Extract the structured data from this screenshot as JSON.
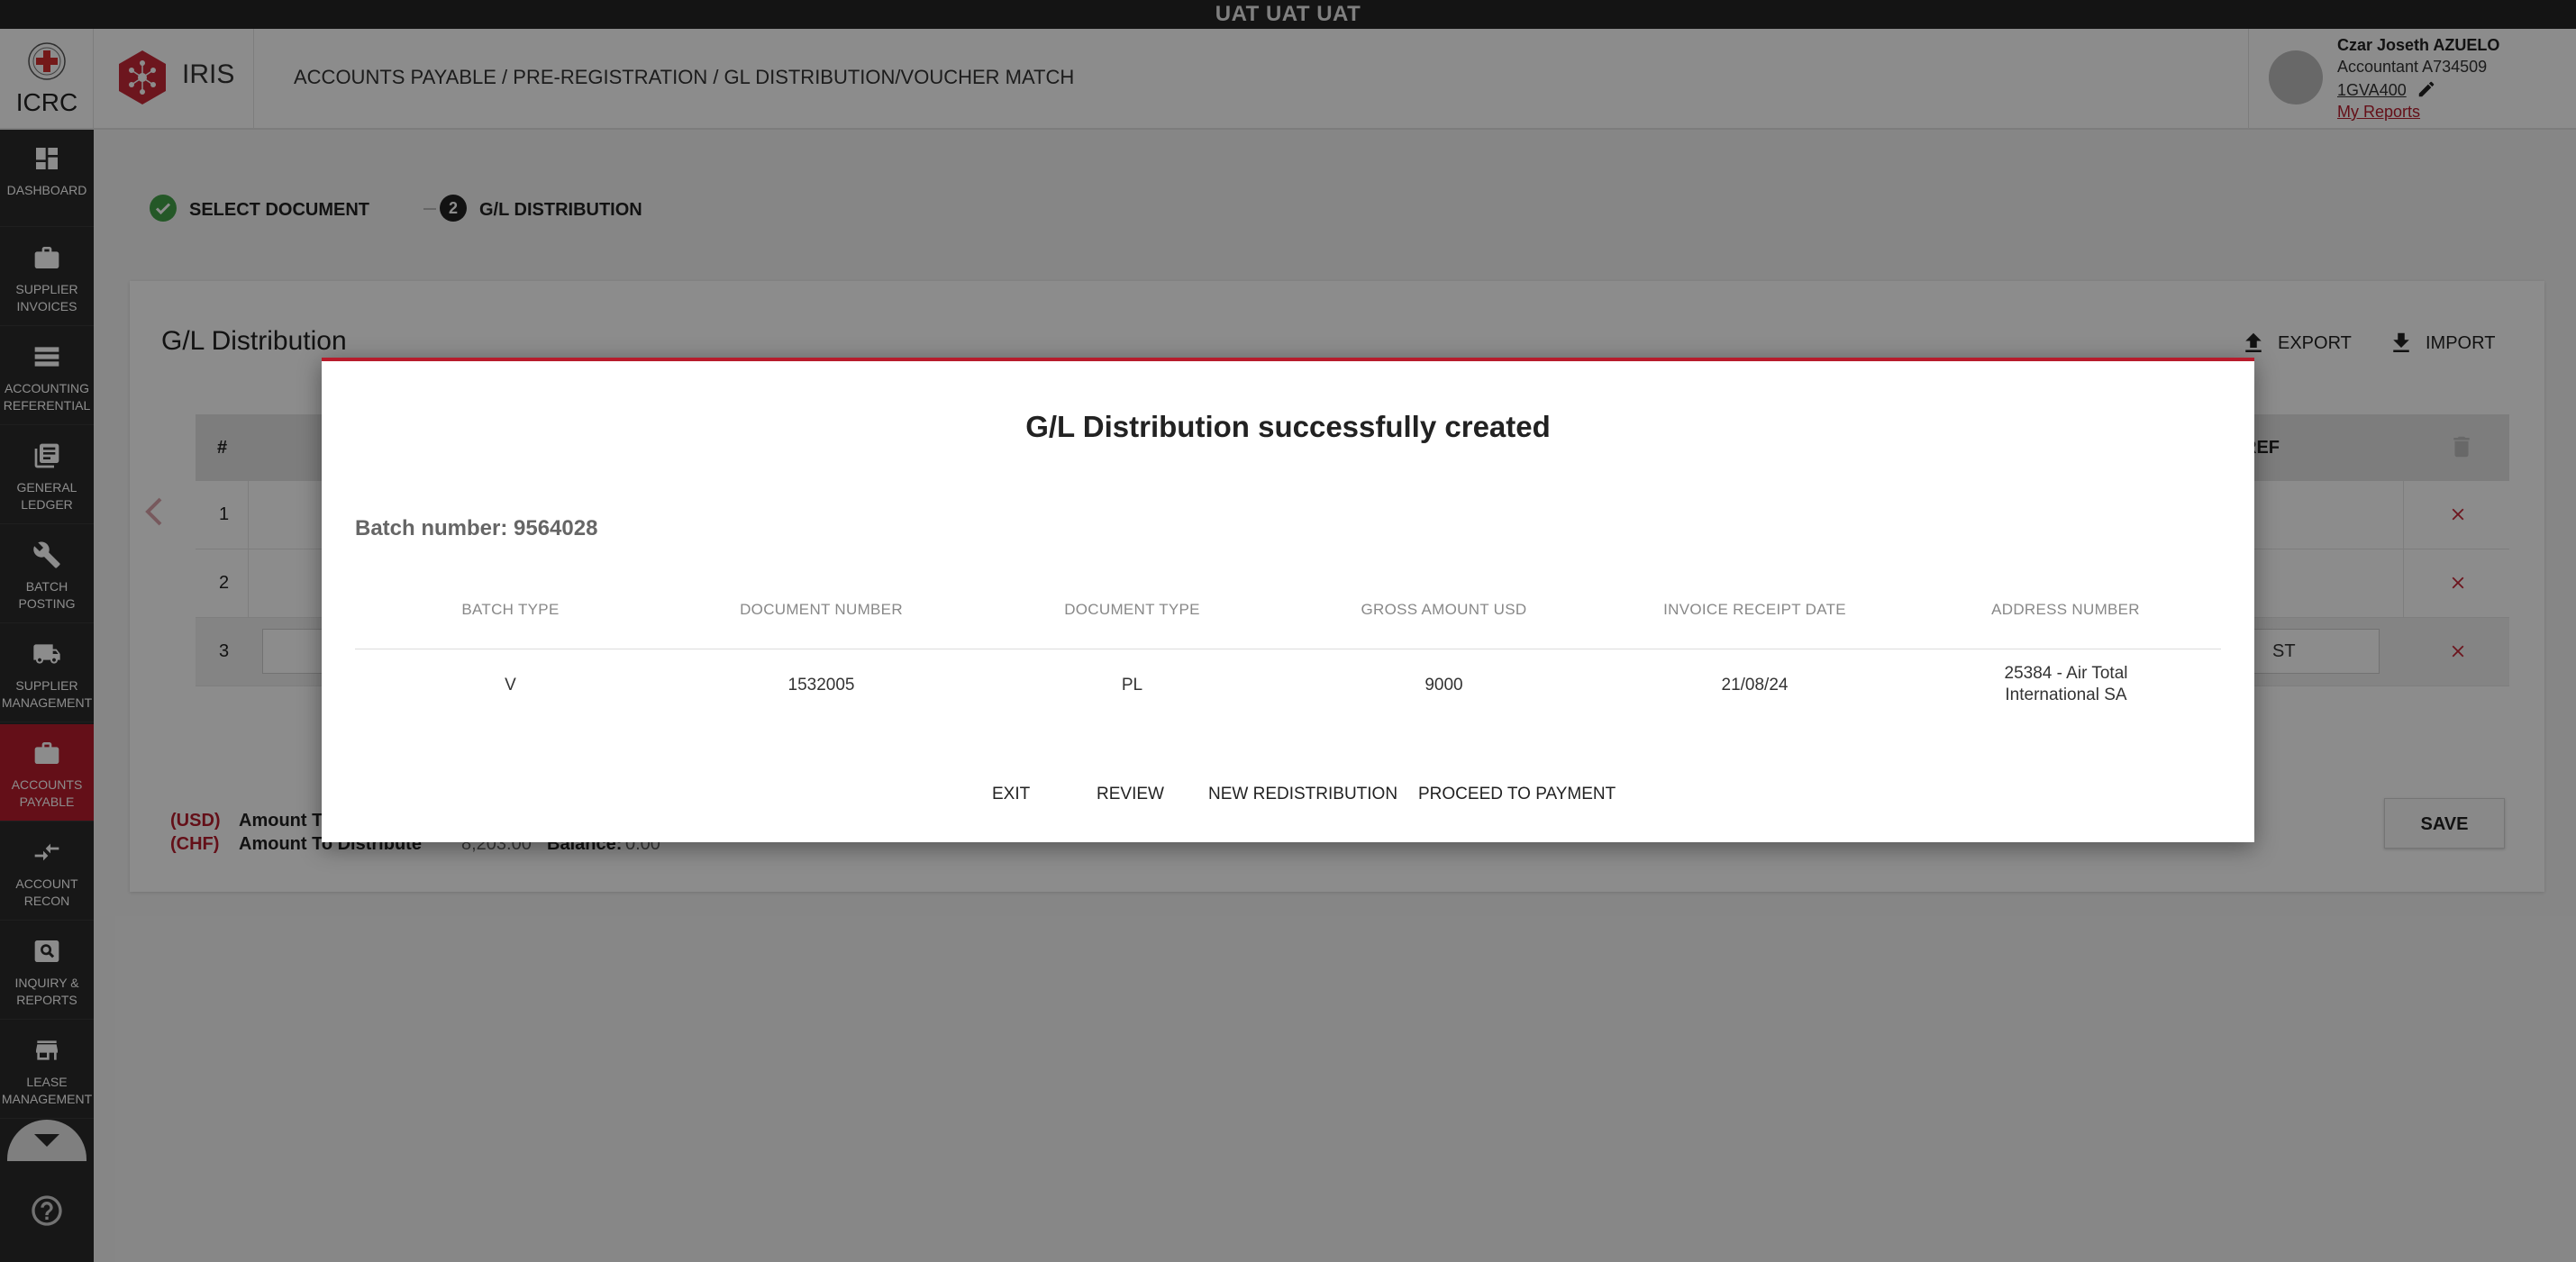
{
  "env_banner": "UAT UAT UAT",
  "header": {
    "org_name": "ICRC",
    "app_name": "IRIS",
    "breadcrumb": "ACCOUNTS PAYABLE / PRE-REGISTRATION / GL DISTRIBUTION/VOUCHER MATCH",
    "user": {
      "name": "Czar Joseth AZUELO",
      "role": "Accountant A734509",
      "code": "1GVA400",
      "reports_link": "My Reports"
    }
  },
  "sidebar": {
    "items": [
      {
        "label": "DASHBOARD",
        "icon": "dashboard-icon"
      },
      {
        "label": "SUPPLIER INVOICES",
        "icon": "briefcase-icon"
      },
      {
        "label": "ACCOUNTING REFERENTIAL",
        "icon": "storage-icon"
      },
      {
        "label": "GENERAL LEDGER",
        "icon": "ledger-icon"
      },
      {
        "label": "BATCH POSTING",
        "icon": "wrench-icon"
      },
      {
        "label": "SUPPLIER MANAGEMENT",
        "icon": "truck-icon"
      },
      {
        "label": "ACCOUNTS PAYABLE",
        "icon": "briefcase-icon",
        "active": true
      },
      {
        "label": "ACCOUNT RECON",
        "icon": "compare-arrows-icon"
      },
      {
        "label": "INQUIRY & REPORTS",
        "icon": "image-search-icon"
      },
      {
        "label": "LEASE MANAGEMENT",
        "icon": "store-icon"
      }
    ]
  },
  "stepper": {
    "step1": "SELECT DOCUMENT",
    "step2_number": "2",
    "step2": "G/L DISTRIBUTION"
  },
  "card": {
    "title": "G/L Distribution",
    "export_label": "EXPORT",
    "import_label": "IMPORT",
    "grid": {
      "col_number": "#",
      "col_ref": "REF",
      "rows": [
        "1",
        "2",
        "3"
      ],
      "row3_input_fragment": "ST"
    },
    "totals": {
      "usd_currency": "(USD)",
      "usd_label": "Amount To",
      "chf_currency": "(CHF)",
      "chf_label": "Amount To Distribute",
      "chf_amount": "8,203.00",
      "balance_label": "Balance:",
      "balance_value": "0.00"
    },
    "save_label": "SAVE"
  },
  "modal": {
    "title": "G/L Distribution successfully created",
    "batch_label": "Batch number: 9564028",
    "columns": [
      "BATCH TYPE",
      "DOCUMENT NUMBER",
      "DOCUMENT TYPE",
      "GROSS AMOUNT USD",
      "INVOICE RECEIPT DATE",
      "ADDRESS NUMBER"
    ],
    "row": {
      "batch_type": "V",
      "document_number": "1532005",
      "document_type": "PL",
      "gross_amount_usd": "9000",
      "invoice_receipt_date": "21/08/24",
      "address_number": "25384 - Air Total International SA"
    },
    "actions": {
      "exit": "EXIT",
      "review": "REVIEW",
      "new_redistribution": "NEW REDISTRIBUTION",
      "proceed_to_payment": "PROCEED TO PAYMENT"
    }
  },
  "colors": {
    "accent": "#b71c2c",
    "sidebar_bg": "#2b2b2b",
    "success": "#43a047",
    "overlay": "rgba(0,0,0,0.45)"
  }
}
